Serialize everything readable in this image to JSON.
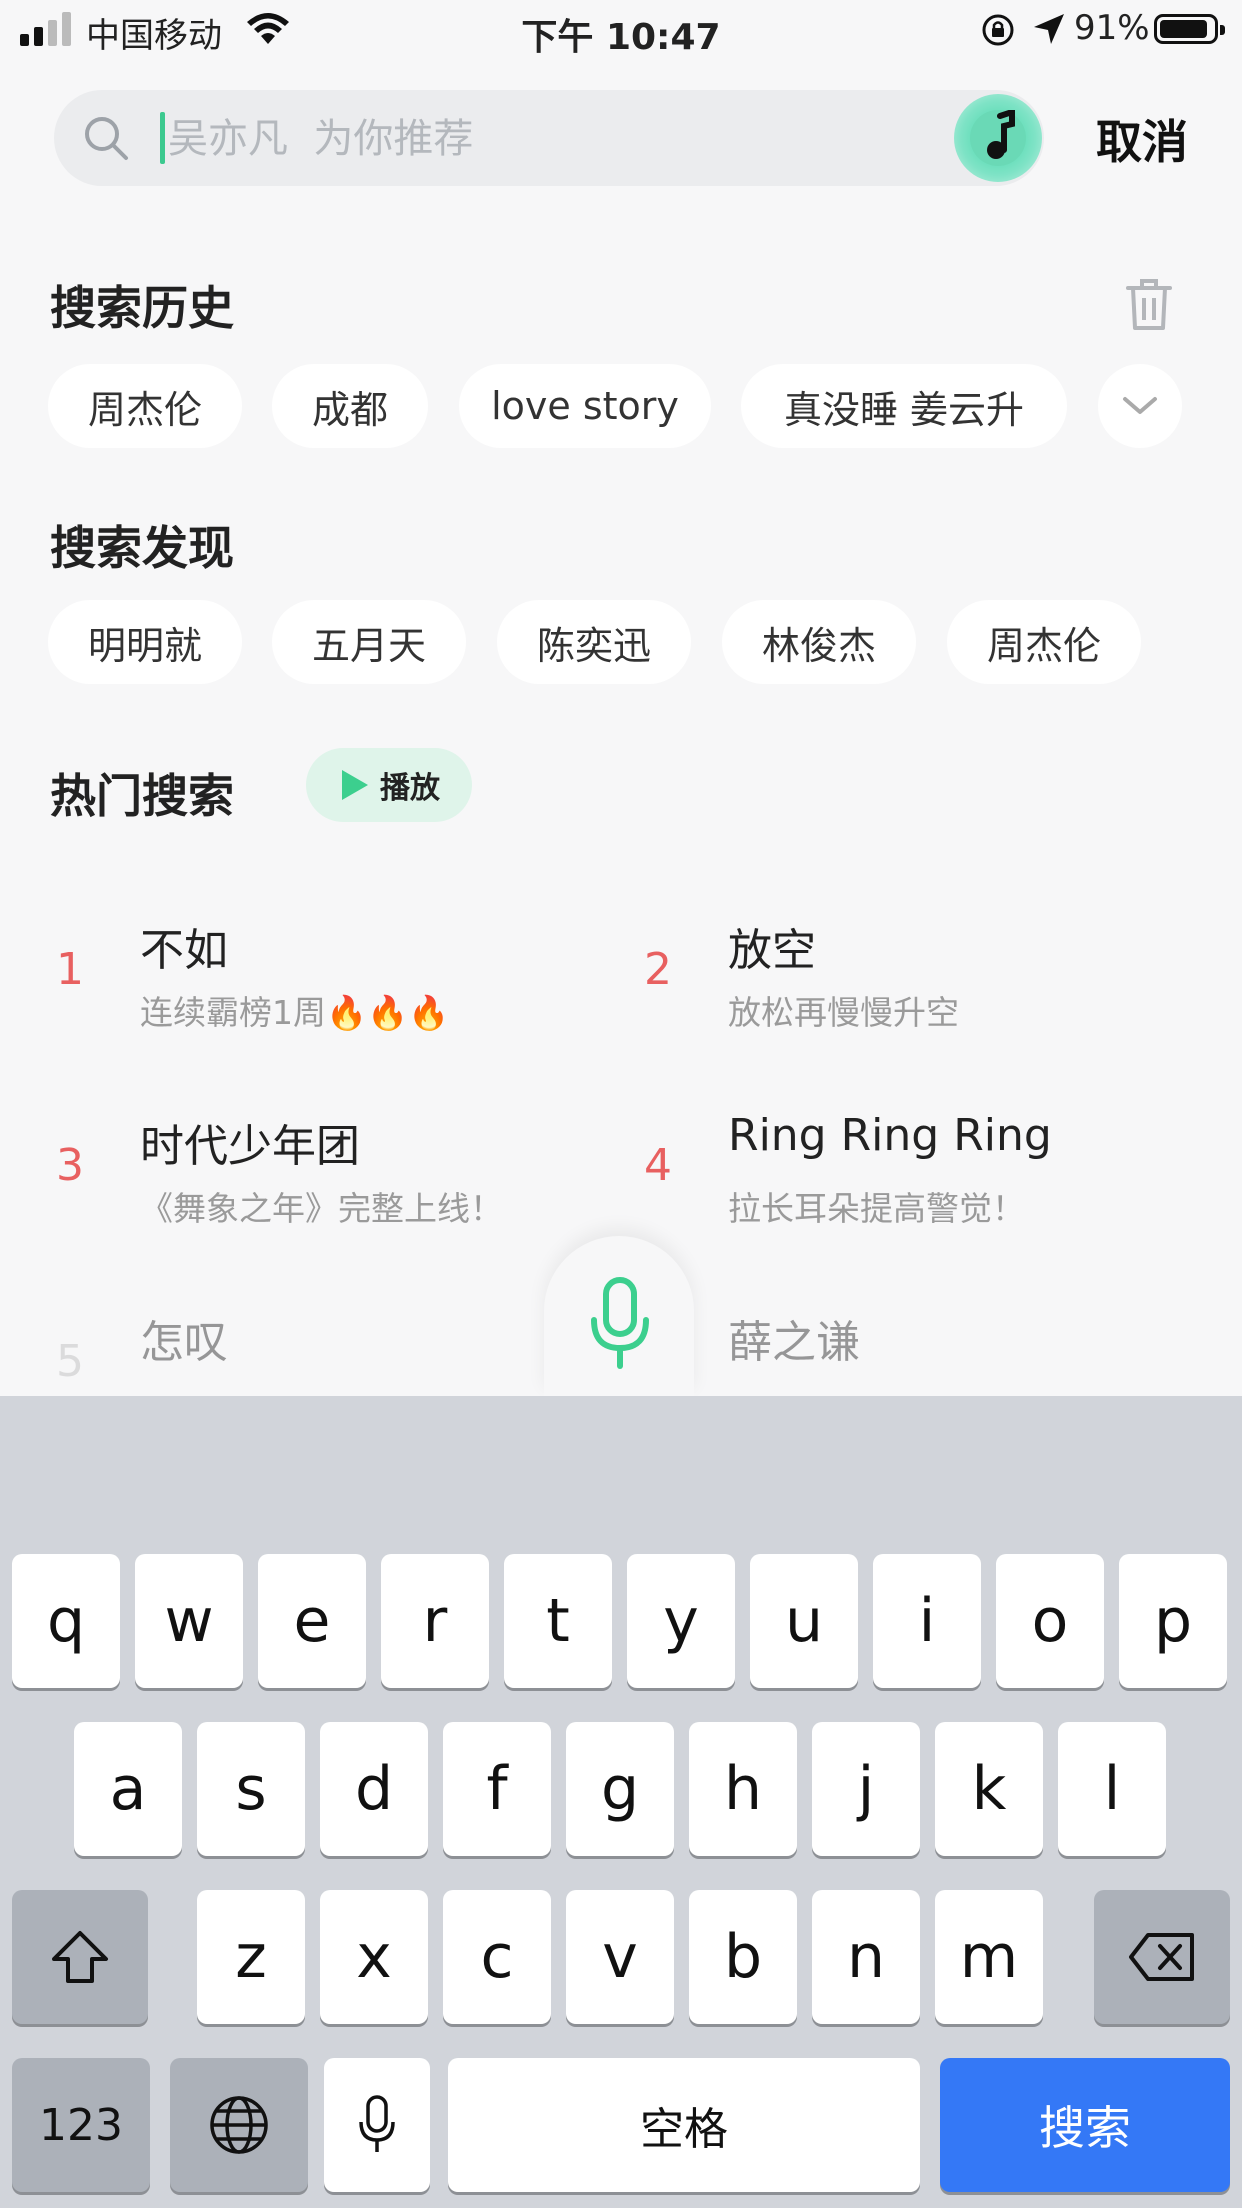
{
  "status_bar": {
    "carrier": "中国移动",
    "time": "下午 10:47",
    "battery_percent": "91%",
    "battery_level": 0.91,
    "icons": [
      "signal-icon",
      "wifi-icon",
      "orientation-lock-icon",
      "location-arrow-icon",
      "battery-icon"
    ]
  },
  "search": {
    "typed_text": "吴亦凡",
    "placeholder": "吴亦凡  为你推荐",
    "cancel_label": "取消"
  },
  "history": {
    "title": "搜索历史",
    "items": [
      "周杰伦",
      "成都",
      "love story",
      "真没睡 姜云升"
    ]
  },
  "discover": {
    "title": "搜索发现",
    "items": [
      "明明就",
      "五月天",
      "陈奕迅",
      "林俊杰",
      "周杰伦"
    ]
  },
  "hot": {
    "title": "热门搜索",
    "play_label": "播放",
    "items": [
      {
        "rank": "1",
        "name": "不如",
        "sub": "连续霸榜1周🔥🔥🔥"
      },
      {
        "rank": "2",
        "name": "放空",
        "sub": "放松再慢慢升空"
      },
      {
        "rank": "3",
        "name": "时代少年团",
        "sub": "《舞象之年》完整上线！"
      },
      {
        "rank": "4",
        "name": "Ring Ring Ring",
        "sub": "拉长耳朵提高警觉！"
      },
      {
        "rank": "5",
        "name": "怎叹",
        "sub": ""
      },
      {
        "rank": "",
        "name": "薛之谦",
        "sub": ""
      }
    ]
  },
  "keyboard": {
    "row1": [
      "q",
      "w",
      "e",
      "r",
      "t",
      "y",
      "u",
      "i",
      "o",
      "p"
    ],
    "row2": [
      "a",
      "s",
      "d",
      "f",
      "g",
      "h",
      "j",
      "k",
      "l"
    ],
    "row3": [
      "z",
      "x",
      "c",
      "v",
      "b",
      "n",
      "m"
    ],
    "numbers_label": "123",
    "space_label": "空格",
    "search_label": "搜索"
  },
  "colors": {
    "accent_green": "#3ccf8e",
    "rank_red": "#e86060",
    "search_key_blue": "#3478f6"
  }
}
